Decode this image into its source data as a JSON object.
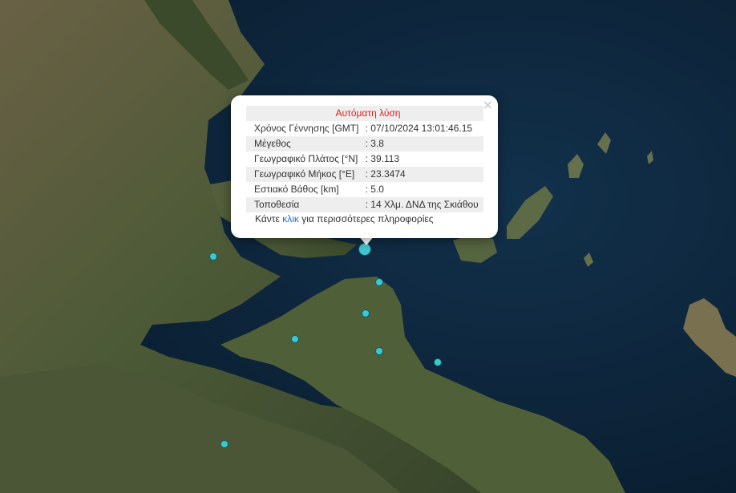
{
  "popup": {
    "title": "Αυτόματη λύση",
    "close_symbol": "×",
    "rows": [
      {
        "label": "Χρόνος Γέννησης [GMT]",
        "value": ": 07/10/2024 13:01:46.15"
      },
      {
        "label": "Μέγεθος",
        "value": ": 3.8"
      },
      {
        "label": "Γεωγραφικό Πλάτος [°N]",
        "value": ": 39.113"
      },
      {
        "label": "Γεωγραφικό Μήκος [°E]",
        "value": ": 23.3474"
      },
      {
        "label": "Εστιακό Βάθος [km]",
        "value": ": 5.0"
      },
      {
        "label": "Τοποθεσία",
        "value": ": 14 Χλμ. ΔΝΔ της Σκιάθου"
      }
    ],
    "more_prefix": "Κάντε ",
    "more_link": "κλικ",
    "more_suffix": " για περισσότερες πληροφορίες"
  },
  "colors": {
    "sea": "#0c2236",
    "land": "#4a5a3a",
    "marker": "#3fc6cf",
    "title": "#e02020",
    "link": "#1c6fc7"
  },
  "markers_icon": "earthquake-marker-icon"
}
